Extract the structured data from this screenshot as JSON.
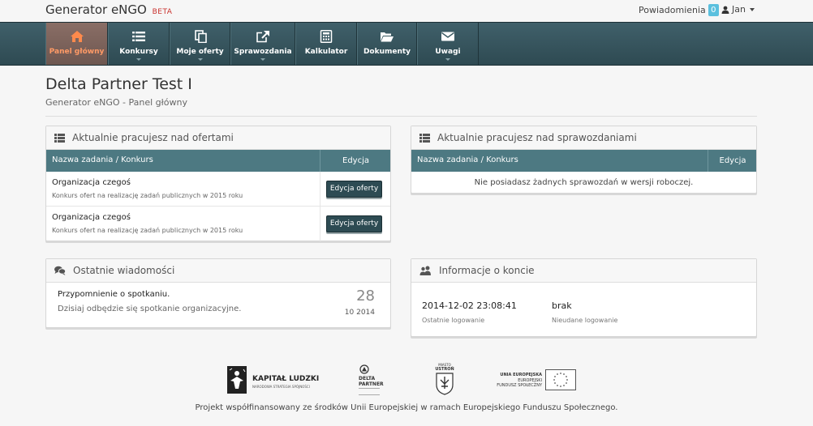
{
  "brand": {
    "name": "Generator eNGO",
    "tag": "BETA"
  },
  "topbar": {
    "notifications_label": "Powiadomienia",
    "notifications_count": "0",
    "user_name": "Jan"
  },
  "nav": [
    {
      "label": "Panel główny",
      "icon": "home-icon",
      "active": true
    },
    {
      "label": "Konkursy",
      "icon": "list-icon",
      "dropdown": true
    },
    {
      "label": "Moje oferty",
      "icon": "copy-icon",
      "dropdown": true
    },
    {
      "label": "Sprawozdania",
      "icon": "external-link-icon",
      "dropdown": true
    },
    {
      "label": "Kalkulator",
      "icon": "calculator-icon"
    },
    {
      "label": "Dokumenty",
      "icon": "folder-open-icon"
    },
    {
      "label": "Uwagi",
      "icon": "envelope-icon",
      "dropdown": true
    }
  ],
  "page": {
    "title": "Delta Partner Test I",
    "subtitle": "Generator eNGO - Panel główny"
  },
  "offers_panel": {
    "title": "Aktualnie pracujesz nad ofertami",
    "col_name": "Nazwa zadania / Konkurs",
    "col_edit": "Edycja",
    "rows": [
      {
        "name": "Organizacja czegoś",
        "contest": "Konkurs ofert na realizację zadań publicznych w 2015 roku",
        "button": "Edycja oferty"
      },
      {
        "name": "Organizacja czegoś",
        "contest": "Konkurs ofert na realizację zadań publicznych w 2015 roku",
        "button": "Edycja oferty"
      }
    ]
  },
  "reports_panel": {
    "title": "Aktualnie pracujesz nad sprawozdaniami",
    "col_name": "Nazwa zadania / Konkurs",
    "col_edit": "Edycja",
    "empty": "Nie posiadasz żadnych sprawozdań w wersji roboczej."
  },
  "messages_panel": {
    "title": "Ostatnie wiadomości",
    "item": {
      "title": "Przypomnienie o spotkaniu.",
      "body": "Dzisiaj odbędzie się spotkanie organizacyjne.",
      "day": "28",
      "month_year": "10 2014"
    }
  },
  "account_panel": {
    "title": "Informacje o koncie",
    "last_login_value": "2014-12-02 23:08:41",
    "last_login_label": "Ostatnie logowanie",
    "failed_value": "brak",
    "failed_label": "Nieudane logowanie"
  },
  "footer": {
    "logo1": {
      "title": "KAPITAŁ LUDZKI",
      "sub": "NARODOWA STRATEGIA SPÓJNOŚCI"
    },
    "logo2": {
      "line1": "DELTA",
      "line2": "PARTNER"
    },
    "logo3": {
      "line1": "MIASTO",
      "line2": "USTROŃ"
    },
    "logo4": {
      "line1": "UNIA EUROPEJSKA",
      "line2": "EUROPEJSKI",
      "line3": "FUNDUSZ SPOŁECZNY"
    },
    "text": "Projekt współfinansowany ze środków Unii Europejskiej w ramach Europejskiego Funduszu Społecznego."
  }
}
